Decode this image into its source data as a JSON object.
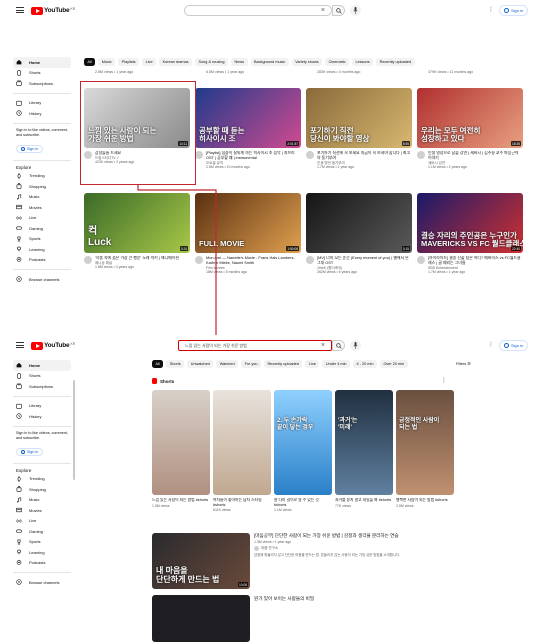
{
  "screen1": {
    "brand": {
      "name": "YouTube",
      "country": "KR"
    },
    "search": {
      "value": ""
    },
    "signin": "Sign in",
    "sidebar": {
      "main": [
        "Home",
        "Shorts",
        "Subscriptions"
      ],
      "you": [
        "Library",
        "History"
      ],
      "note": "Sign in to like videos, comment, and subscribe.",
      "signin": "Sign in",
      "explore_heading": "Explore",
      "explore": [
        "Trending",
        "Shopping",
        "Music",
        "Movies",
        "Live",
        "Gaming",
        "Sports",
        "Learning",
        "Podcasts"
      ],
      "browse": "Browse channels"
    },
    "chips": [
      "All",
      "Music",
      "Playlists",
      "Live",
      "Korean dramas",
      "Song & rousing",
      "News",
      "Background music",
      "Variety shows",
      "Cinematic",
      "Lessons",
      "Recently uploaded"
    ],
    "prev_row_meta": [
      "2.8M views • 1 year ago",
      "6.5M views • 1 year ago",
      "283K views • 4 months ago",
      "479K views • 11 months ago"
    ],
    "videos": [
      {
        "overlay": "느낌 있는 사람이 되는\n가장 쉬운 방법",
        "duration": "14:11",
        "title": "감성돌들 드세요",
        "channel": "드림스터디TV ✓",
        "meta": "423K views • 2 years ago",
        "c1": "#d9d9d9",
        "c2": "#8a8a8a"
      },
      {
        "overlay": "공부할 때 듣는\n히사이시 조",
        "duration": "2:01:57",
        "title": "[Playlist] 집중이 잘되게 하는 히사이시 조 음악 | 지브리 OST | 공부할 때 | instrumental",
        "channel": "오르골 뮤직",
        "meta": "2.5M views • 10 months ago",
        "c1": "#1f3b8c",
        "c2": "#d04a8f"
      },
      {
        "overlay": "포기하기 직전\n당신이 봐야할 영상",
        "duration": "8:55",
        "title": "포기하기 직전에 꼭 보세요 지금이 꼭 보셔야 합니다 | 최고의 동기부여",
        "channel": "인생 명언 동기부여",
        "meta": "1.7M views • 1 year ago",
        "c1": "#8a6a3a",
        "c2": "#d8b870"
      },
      {
        "overlay": "우리는 모두 여전히\n성장하고 있다",
        "duration": "18:35",
        "title": "인생 영상으로 남을 강연 | 세바시 | 김주환 교수 마음근력 이야기",
        "channel": "세바시 강연",
        "meta": "1.1M views • 2 years ago",
        "c1": "#b03030",
        "c2": "#e8a080"
      },
      {
        "overlay": "컥\nLuck",
        "duration": "3:24",
        "title": "'작품 속에 숨은 가장 큰 행운' 노래 럭키 | 애니메이션",
        "channel": "애니송 채널",
        "meta": "1.8M views • 3 years ago",
        "c1": "#3a6a28",
        "c2": "#a8c848"
      },
      {
        "overlay": "FULL MOVIE",
        "duration": "1:50:06",
        "title": "Mon Ami — Nanette's Movie - Frans Hals Lambers, Kathrin Mieke, Naomi Smith",
        "channel": "Film Movies",
        "meta": "18M views • 5 months ago",
        "c1": "#5a3010",
        "c2": "#e0a050"
      },
      {
        "overlay": "",
        "duration": "3:15",
        "title": "[MV] 너의 모든 순간 (Every moment of you) | 별에서 온 그대 OST",
        "channel": "1theK (원더케이)",
        "meta": "262M views • 6 years ago",
        "c1": "#151515",
        "c2": "#5a5a5a"
      },
      {
        "overlay": "결승 자리의 주인공은 누구인가\nMAVERICKS VS FC 월드클래스",
        "duration": "22:40",
        "title": "[하이라이트] 결승 진출 팀은 어디? 매버릭스 vs FC월드클래스 | 골 때리는 그녀들",
        "channel": "SBS Entertainment",
        "meta": "1.7M views • 1 year ago",
        "c1": "#1a1a6a",
        "c2": "#d03030"
      }
    ]
  },
  "screen2": {
    "search": {
      "value": "느낌 있는 사람이 되는 가장 쉬운 방법"
    },
    "signin": "Sign in",
    "chips": [
      "All",
      "Shorts",
      "Unwatched",
      "Watched",
      "For you",
      "Recently uploaded",
      "Live",
      "Under 4 min",
      "4 - 20 min",
      "Over 20 min"
    ],
    "filters": "Filters",
    "shorts_heading": "Shorts",
    "shorts": [
      {
        "overlay": "",
        "title": "느낌 있는 사람이 되는 방법 #shorts",
        "views": "1.3M views",
        "c1": "#d8d0c8",
        "c2": "#b09080"
      },
      {
        "overlay": "",
        "title": "여자들이 좋아하는 남자 스타일 #shorts",
        "views": "611K views",
        "c1": "#e8e2dc",
        "c2": "#c0a890"
      },
      {
        "overlay": "2. 두 손가락\n끝이 닿는 경우",
        "title": "팔 다리 길이로 알 수 있는 것 #shorts",
        "views": "1.1M views",
        "c1": "#8fd0ff",
        "c2": "#2a80c8"
      },
      {
        "overlay": "'과거'는\n'미래'",
        "title": "과거를 묻지 말고 내일을 봐 #shorts",
        "views": "77K views",
        "c1": "#203040",
        "c2": "#6080a0"
      },
      {
        "overlay": "긍정적인 사람이\n되는 법",
        "title": "행복한 사람이 되는 방법 #shorts",
        "views": "2.5M views",
        "c1": "#6a5040",
        "c2": "#c09070"
      }
    ],
    "result": {
      "overlay": "내 마음을\n단단하게 만드는 법",
      "duration": "10:06",
      "title": "[마음공부] 단단한 사람이 되는 가장 쉬운 방법 | 감정과 생각을 분리하는 연습",
      "meta": "1.3M views • 1 year ago",
      "channel": "마음 연구소",
      "desc": "감정에 휘둘리지 않고 단단한 마음을 만드는 법. 흔들리지 않는 사람이 되는 가장 쉬운 방법을 소개합니다."
    },
    "result2_title": "뭔가 있어 보이는 사람들의 비밀"
  },
  "colors": {
    "brand_red": "#ff0000",
    "highlight_red": "#c1272d",
    "link_blue": "#065fd4"
  }
}
